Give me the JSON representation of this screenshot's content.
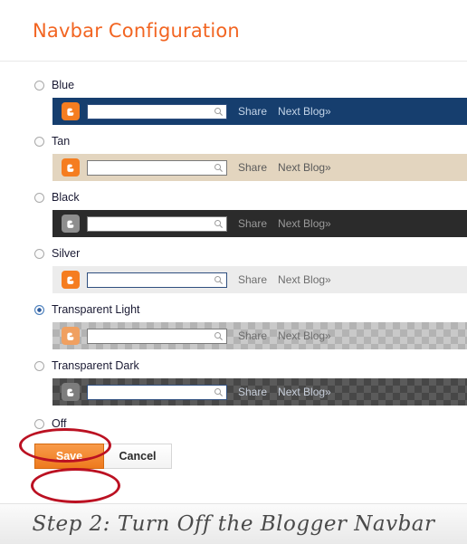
{
  "dialog": {
    "title": "Navbar Configuration",
    "save_label": "Save",
    "cancel_label": "Cancel",
    "accent_color": "#f26522",
    "save_button_color": "#ee7a1e"
  },
  "navbar_preview": {
    "share_label": "Share",
    "next_blog_label": "Next Blog»",
    "search_placeholder": "",
    "search_value": ""
  },
  "options": [
    {
      "id": "blue",
      "label": "Blue",
      "selected": false,
      "bar_color": "#163e6e",
      "link_color": "#c3d4e8"
    },
    {
      "id": "tan",
      "label": "Tan",
      "selected": false,
      "bar_color": "#e3d5bf",
      "link_color": "#5a5a5a"
    },
    {
      "id": "black",
      "label": "Black",
      "selected": false,
      "bar_color": "#2b2b2b",
      "link_color": "#9a9a9a"
    },
    {
      "id": "silver",
      "label": "Silver",
      "selected": false,
      "bar_color": "#ececec",
      "link_color": "#6d6d6d"
    },
    {
      "id": "transparent-light",
      "label": "Transparent Light",
      "selected": true,
      "bar_color": "#c9c9c9",
      "link_color": "#6d6d6d"
    },
    {
      "id": "transparent-dark",
      "label": "Transparent Dark",
      "selected": false,
      "bar_color": "#5b5b5b",
      "link_color": "#c8cfdb"
    },
    {
      "id": "off",
      "label": "Off",
      "selected": false,
      "bar_color": null,
      "link_color": null
    }
  ],
  "annotations": {
    "color": "#bb1122",
    "shapes": [
      "ellipse-around-off-radio",
      "ellipse-around-save-button"
    ]
  },
  "caption": {
    "text": "Step 2: Turn Off the Blogger Navbar"
  }
}
